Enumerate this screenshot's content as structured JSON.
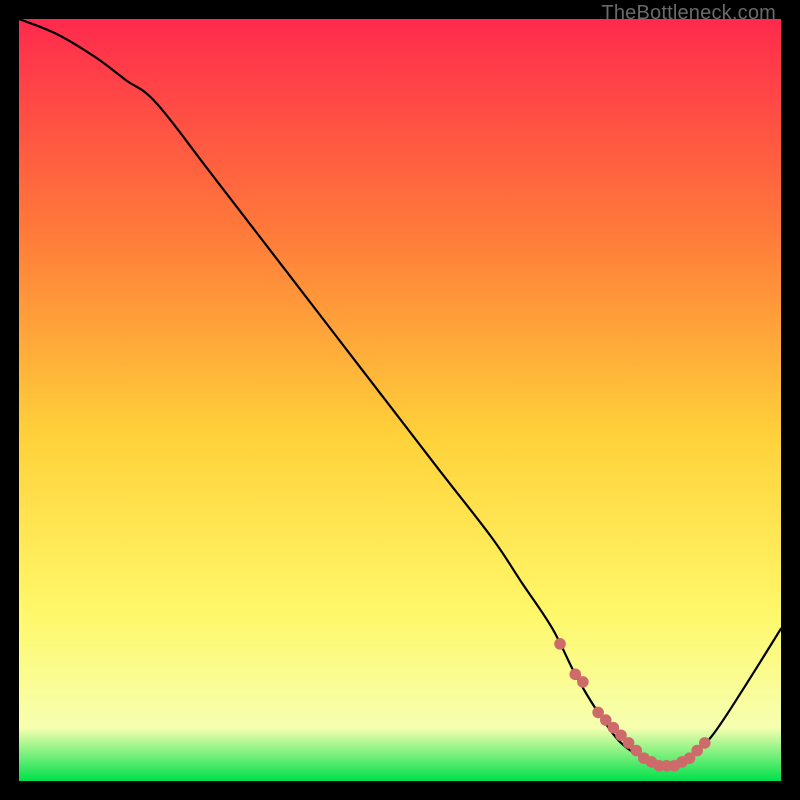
{
  "watermark": "TheBottleneck.com",
  "colors": {
    "bg": "#000000",
    "gradient_top": "#ff2a4d",
    "gradient_mid_upper": "#ff7a3a",
    "gradient_mid": "#ffd23a",
    "gradient_mid_lower": "#fff86a",
    "gradient_lower": "#f6ffb0",
    "gradient_bottom": "#00e04a",
    "curve": "#000000",
    "marker": "#cf6a6a"
  },
  "chart_data": {
    "type": "line",
    "title": "",
    "xlabel": "",
    "ylabel": "",
    "xlim": [
      0,
      100
    ],
    "ylim": [
      0,
      100
    ],
    "grid": false,
    "series": [
      {
        "name": "bottleneck-curve",
        "x": [
          0,
          5,
          10,
          14,
          18,
          25,
          35,
          45,
          55,
          62,
          66,
          70,
          73,
          76,
          79,
          82,
          84,
          86,
          88,
          91,
          95,
          100
        ],
        "y": [
          100,
          98,
          95,
          92,
          89,
          80,
          67,
          54,
          41,
          32,
          26,
          20,
          14,
          9,
          5,
          3,
          2,
          2,
          3,
          6,
          12,
          20
        ]
      }
    ],
    "markers": {
      "name": "flat-region-markers",
      "x": [
        71,
        73,
        74,
        76,
        77,
        78,
        79,
        80,
        81,
        82,
        83,
        84,
        85,
        86,
        87,
        88,
        89,
        90
      ],
      "y": [
        18,
        14,
        13,
        9,
        8,
        7,
        6,
        5,
        4,
        3,
        2.5,
        2,
        2,
        2,
        2.5,
        3,
        4,
        5
      ]
    }
  }
}
